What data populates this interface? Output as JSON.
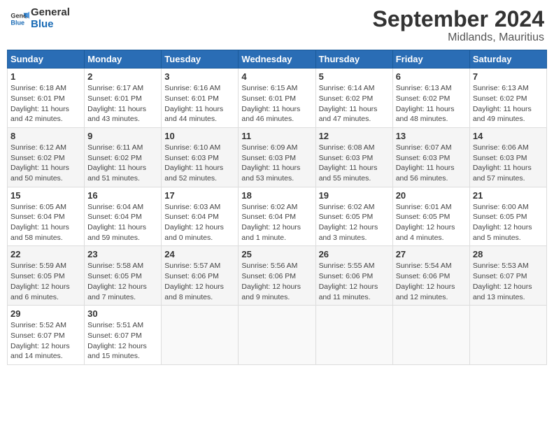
{
  "header": {
    "logo_line1": "General",
    "logo_line2": "Blue",
    "month_title": "September 2024",
    "subtitle": "Midlands, Mauritius"
  },
  "weekdays": [
    "Sunday",
    "Monday",
    "Tuesday",
    "Wednesday",
    "Thursday",
    "Friday",
    "Saturday"
  ],
  "weeks": [
    [
      {
        "day": "1",
        "info": "Sunrise: 6:18 AM\nSunset: 6:01 PM\nDaylight: 11 hours\nand 42 minutes."
      },
      {
        "day": "2",
        "info": "Sunrise: 6:17 AM\nSunset: 6:01 PM\nDaylight: 11 hours\nand 43 minutes."
      },
      {
        "day": "3",
        "info": "Sunrise: 6:16 AM\nSunset: 6:01 PM\nDaylight: 11 hours\nand 44 minutes."
      },
      {
        "day": "4",
        "info": "Sunrise: 6:15 AM\nSunset: 6:01 PM\nDaylight: 11 hours\nand 46 minutes."
      },
      {
        "day": "5",
        "info": "Sunrise: 6:14 AM\nSunset: 6:02 PM\nDaylight: 11 hours\nand 47 minutes."
      },
      {
        "day": "6",
        "info": "Sunrise: 6:13 AM\nSunset: 6:02 PM\nDaylight: 11 hours\nand 48 minutes."
      },
      {
        "day": "7",
        "info": "Sunrise: 6:13 AM\nSunset: 6:02 PM\nDaylight: 11 hours\nand 49 minutes."
      }
    ],
    [
      {
        "day": "8",
        "info": "Sunrise: 6:12 AM\nSunset: 6:02 PM\nDaylight: 11 hours\nand 50 minutes."
      },
      {
        "day": "9",
        "info": "Sunrise: 6:11 AM\nSunset: 6:02 PM\nDaylight: 11 hours\nand 51 minutes."
      },
      {
        "day": "10",
        "info": "Sunrise: 6:10 AM\nSunset: 6:03 PM\nDaylight: 11 hours\nand 52 minutes."
      },
      {
        "day": "11",
        "info": "Sunrise: 6:09 AM\nSunset: 6:03 PM\nDaylight: 11 hours\nand 53 minutes."
      },
      {
        "day": "12",
        "info": "Sunrise: 6:08 AM\nSunset: 6:03 PM\nDaylight: 11 hours\nand 55 minutes."
      },
      {
        "day": "13",
        "info": "Sunrise: 6:07 AM\nSunset: 6:03 PM\nDaylight: 11 hours\nand 56 minutes."
      },
      {
        "day": "14",
        "info": "Sunrise: 6:06 AM\nSunset: 6:03 PM\nDaylight: 11 hours\nand 57 minutes."
      }
    ],
    [
      {
        "day": "15",
        "info": "Sunrise: 6:05 AM\nSunset: 6:04 PM\nDaylight: 11 hours\nand 58 minutes."
      },
      {
        "day": "16",
        "info": "Sunrise: 6:04 AM\nSunset: 6:04 PM\nDaylight: 11 hours\nand 59 minutes."
      },
      {
        "day": "17",
        "info": "Sunrise: 6:03 AM\nSunset: 6:04 PM\nDaylight: 12 hours\nand 0 minutes."
      },
      {
        "day": "18",
        "info": "Sunrise: 6:02 AM\nSunset: 6:04 PM\nDaylight: 12 hours\nand 1 minute."
      },
      {
        "day": "19",
        "info": "Sunrise: 6:02 AM\nSunset: 6:05 PM\nDaylight: 12 hours\nand 3 minutes."
      },
      {
        "day": "20",
        "info": "Sunrise: 6:01 AM\nSunset: 6:05 PM\nDaylight: 12 hours\nand 4 minutes."
      },
      {
        "day": "21",
        "info": "Sunrise: 6:00 AM\nSunset: 6:05 PM\nDaylight: 12 hours\nand 5 minutes."
      }
    ],
    [
      {
        "day": "22",
        "info": "Sunrise: 5:59 AM\nSunset: 6:05 PM\nDaylight: 12 hours\nand 6 minutes."
      },
      {
        "day": "23",
        "info": "Sunrise: 5:58 AM\nSunset: 6:05 PM\nDaylight: 12 hours\nand 7 minutes."
      },
      {
        "day": "24",
        "info": "Sunrise: 5:57 AM\nSunset: 6:06 PM\nDaylight: 12 hours\nand 8 minutes."
      },
      {
        "day": "25",
        "info": "Sunrise: 5:56 AM\nSunset: 6:06 PM\nDaylight: 12 hours\nand 9 minutes."
      },
      {
        "day": "26",
        "info": "Sunrise: 5:55 AM\nSunset: 6:06 PM\nDaylight: 12 hours\nand 11 minutes."
      },
      {
        "day": "27",
        "info": "Sunrise: 5:54 AM\nSunset: 6:06 PM\nDaylight: 12 hours\nand 12 minutes."
      },
      {
        "day": "28",
        "info": "Sunrise: 5:53 AM\nSunset: 6:07 PM\nDaylight: 12 hours\nand 13 minutes."
      }
    ],
    [
      {
        "day": "29",
        "info": "Sunrise: 5:52 AM\nSunset: 6:07 PM\nDaylight: 12 hours\nand 14 minutes."
      },
      {
        "day": "30",
        "info": "Sunrise: 5:51 AM\nSunset: 6:07 PM\nDaylight: 12 hours\nand 15 minutes."
      },
      {
        "day": "",
        "info": ""
      },
      {
        "day": "",
        "info": ""
      },
      {
        "day": "",
        "info": ""
      },
      {
        "day": "",
        "info": ""
      },
      {
        "day": "",
        "info": ""
      }
    ]
  ]
}
